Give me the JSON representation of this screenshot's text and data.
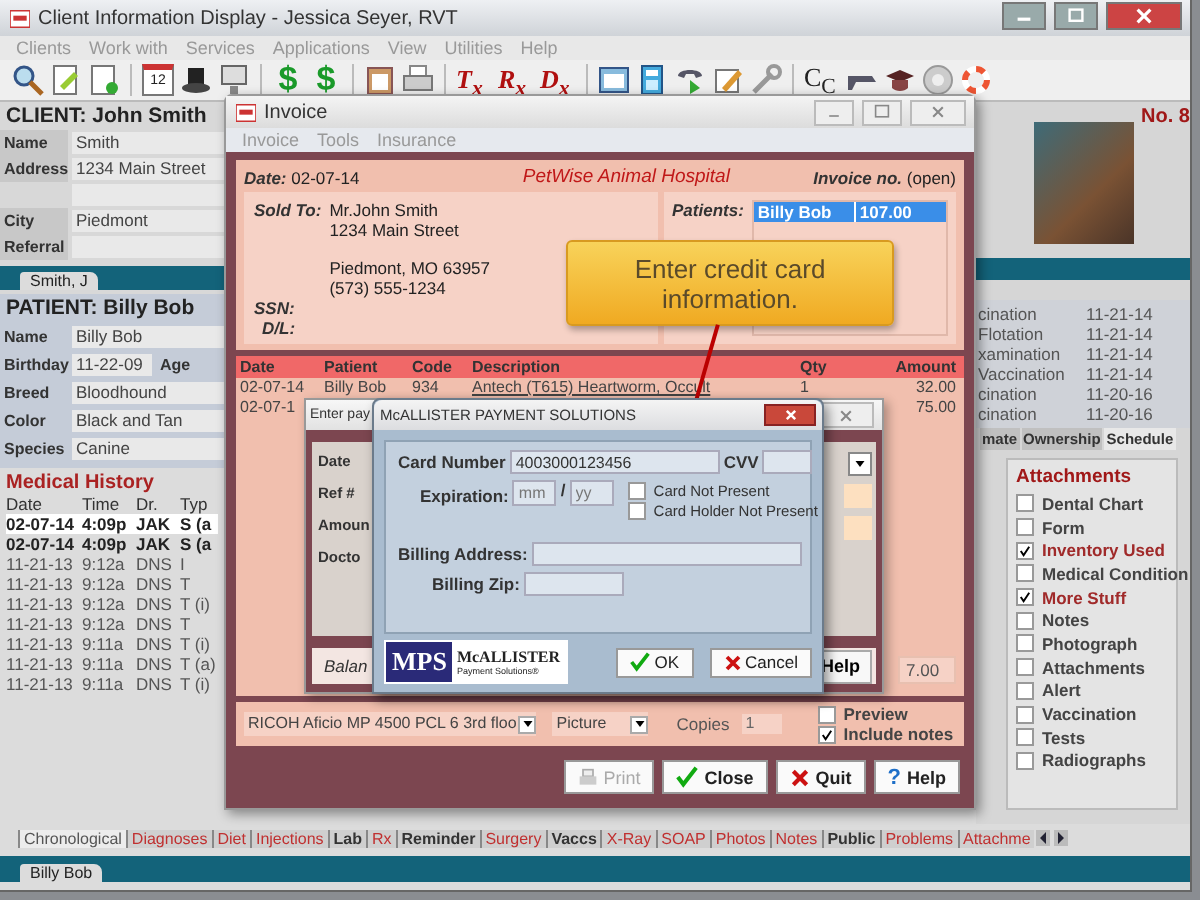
{
  "window": {
    "title": "Client Information Display - Jessica Seyer, RVT"
  },
  "menu": [
    {
      "label": "Clients",
      "disabled": true
    },
    {
      "label": "Work with",
      "disabled": true
    },
    {
      "label": "Services",
      "disabled": true
    },
    {
      "label": "Applications",
      "disabled": true
    },
    {
      "label": "View",
      "disabled": true
    },
    {
      "label": "Utilities",
      "disabled": true
    },
    {
      "label": "Help",
      "disabled": true
    }
  ],
  "toolbar": {
    "calendar_day": "12",
    "dollar_signs": [
      "$",
      "$"
    ],
    "rx_buttons": [
      "T$_{x}$",
      "R$_{x}$",
      "D$_{x}$"
    ],
    "cc_label": "C$_{C}$"
  },
  "client": {
    "heading": "CLIENT:",
    "name": "John Smith",
    "fields": [
      {
        "label": "Name",
        "value": "Smith",
        "kind": "line"
      },
      {
        "label": "Address",
        "value": "1234 Main Street",
        "kind": "address"
      },
      {
        "label": "City",
        "value": "Piedmont",
        "kind": "line"
      },
      {
        "label": "Referral",
        "kind": "line"
      }
    ]
  },
  "client_tab": "Smith, J",
  "patient": {
    "heading": "PATIENT:",
    "name": "Billy Bob",
    "fields": [
      {
        "label": "Name",
        "value": "Billy Bob"
      },
      {
        "label": "Birthday",
        "value": "11-22-09",
        "extra_label": "Age"
      },
      {
        "label": "Breed",
        "value": "Bloodhound"
      },
      {
        "label": "Color",
        "value": "Black and Tan"
      },
      {
        "label": "Species",
        "value": "Canine"
      }
    ]
  },
  "medical_history": {
    "title": "Medical History",
    "columns": [
      "Date",
      "Time",
      "Dr.",
      "Typ"
    ],
    "rows": [
      {
        "cells": [
          "02-07-14",
          "4:09p",
          "JAK",
          "S (a"
        ],
        "selected": true,
        "bold": true
      },
      {
        "cells": [
          "02-07-14",
          "4:09p",
          "JAK",
          "S (a"
        ],
        "selected": false,
        "bold": true
      },
      {
        "cells": [
          "11-21-13",
          "9:12a",
          "DNS",
          "I"
        ],
        "selected": false,
        "bold": false
      },
      {
        "cells": [
          "11-21-13",
          "9:12a",
          "DNS",
          "T"
        ],
        "selected": false,
        "bold": false
      },
      {
        "cells": [
          "11-21-13",
          "9:12a",
          "DNS",
          "T (i)"
        ],
        "selected": false,
        "bold": false
      },
      {
        "cells": [
          "11-21-13",
          "9:12a",
          "DNS",
          "T"
        ],
        "selected": false,
        "bold": false
      },
      {
        "cells": [
          "11-21-13",
          "9:11a",
          "DNS",
          "T (i)"
        ],
        "selected": false,
        "bold": false
      },
      {
        "cells": [
          "11-21-13",
          "9:11a",
          "DNS",
          "T (a)"
        ],
        "selected": false,
        "bold": false
      },
      {
        "cells": [
          "11-21-13",
          "9:11a",
          "DNS",
          "T (i)"
        ],
        "selected": false,
        "bold": false
      }
    ]
  },
  "record_tabs": [
    {
      "label": "Chronological",
      "selected": true,
      "empty": false
    },
    {
      "label": "Diagnoses",
      "selected": false,
      "empty": true
    },
    {
      "label": "Diet",
      "selected": false,
      "empty": true
    },
    {
      "label": "Injections",
      "selected": false,
      "empty": true
    },
    {
      "label": "Lab",
      "selected": false,
      "empty": false
    },
    {
      "label": "Rx",
      "selected": false,
      "empty": true
    },
    {
      "label": "Reminder",
      "selected": false,
      "empty": false
    },
    {
      "label": "Surgery",
      "selected": false,
      "empty": true
    },
    {
      "label": "Vaccs",
      "selected": false,
      "empty": false
    },
    {
      "label": "X-Ray",
      "selected": false,
      "empty": true
    },
    {
      "label": "SOAP",
      "selected": false,
      "empty": true
    },
    {
      "label": "Photos",
      "selected": false,
      "empty": true
    },
    {
      "label": "Notes",
      "selected": false,
      "empty": true
    },
    {
      "label": "Public",
      "selected": false,
      "empty": false
    },
    {
      "label": "Problems",
      "selected": false,
      "empty": true
    },
    {
      "label": "Attachme",
      "selected": false,
      "empty": true
    }
  ],
  "patient_tab": "Billy Bob",
  "right_panel": {
    "number": "No. 8",
    "vaccinations": [
      {
        "name": "cination",
        "date": "11-21-14"
      },
      {
        "name": "Flotation",
        "date": "11-21-14"
      },
      {
        "name": "xamination",
        "date": "11-21-14"
      },
      {
        "name": "Vaccination",
        "date": "11-21-14"
      },
      {
        "name": "cination",
        "date": "11-20-16"
      },
      {
        "name": "cination",
        "date": "11-20-16"
      }
    ],
    "tabs": [
      {
        "label": "mate",
        "selected": false
      },
      {
        "label": "Ownership",
        "selected": false
      },
      {
        "label": "Schedule",
        "selected": true
      }
    ]
  },
  "attachments": {
    "title": "Attachments",
    "items": [
      {
        "label": "Dental Chart",
        "checked": false
      },
      {
        "label": "Form",
        "checked": false
      },
      {
        "label": "Inventory Used",
        "checked": true
      },
      {
        "label": "Medical Condition",
        "checked": false
      },
      {
        "label": "More Stuff",
        "checked": true
      },
      {
        "label": "Notes",
        "checked": false
      },
      {
        "label": "Photograph",
        "checked": false
      },
      {
        "label": "Attachments",
        "checked": false
      },
      {
        "label": "Alert",
        "checked": false
      },
      {
        "label": "Vaccination",
        "checked": false
      },
      {
        "label": "Tests",
        "checked": false
      },
      {
        "label": "Radiographs",
        "checked": false
      }
    ]
  },
  "invoice": {
    "title": "Invoice",
    "menu": [
      "Invoice",
      "Tools",
      "Insurance"
    ],
    "date_label": "Date:",
    "date": "02-07-14",
    "hospital": "PetWise Animal Hospital",
    "invoice_no_label": "Invoice no.",
    "invoice_no": "(open)",
    "sold_to_label": "Sold To:",
    "address_lines": [
      "Mr.John Smith",
      "1234 Main Street"
    ],
    "city_lines": [
      "Piedmont, MO  63957",
      "(573) 555-1234"
    ],
    "ssn_label": "SSN:",
    "dl_label": "D/L:",
    "patients_label": "Patients:",
    "patients": [
      {
        "name": "Billy Bob",
        "amount": "107.00",
        "selected": true
      }
    ],
    "columns": [
      "Date",
      "Patient",
      "Code",
      "Description",
      "Qty",
      "Amount"
    ],
    "items": [
      {
        "date": "02-07-14",
        "patient": "Billy Bob",
        "code": "934",
        "description": "Antech (T615) Heartworm, Occult",
        "qty": "1",
        "amount": "32.00"
      },
      {
        "date": "02-07-1",
        "amount": "75.00"
      }
    ],
    "balance": "7.00",
    "printer": "RICOH Aficio MP 4500 PCL 6 3rd floo",
    "format": "Picture",
    "copies_label": "Copies",
    "copies": "1",
    "options": [
      {
        "label": "Preview",
        "checked": false
      },
      {
        "label": "Include notes",
        "checked": true
      }
    ],
    "buttons": [
      {
        "label": "Print",
        "kind": "print",
        "disabled": true
      },
      {
        "label": "Close",
        "kind": "close",
        "disabled": false
      },
      {
        "label": "Quit",
        "kind": "quit",
        "disabled": false
      },
      {
        "label": "Help",
        "kind": "help",
        "disabled": false,
        "glyph": "?"
      }
    ]
  },
  "payment_window": {
    "title": "Enter pay",
    "labels": [
      "Date",
      "Ref #",
      "Amoun",
      "Docto"
    ],
    "balance_label": "Balan",
    "help_button": "Help"
  },
  "mcallister": {
    "title": "McALLISTER PAYMENT SOLUTIONS",
    "card_number_label": "Card Number",
    "card_number": "4003000123456",
    "cvv_label": "CVV",
    "expiration_label": "Expiration:",
    "month_placeholder": "mm",
    "separator": "/",
    "year_placeholder": "yy",
    "checks": [
      {
        "label": "Card Not Present",
        "checked": false
      },
      {
        "label": "Card Holder Not Present",
        "checked": false
      }
    ],
    "billing_address_label": "Billing Address:",
    "billing_zip_label": "Billing Zip:",
    "logo_mark": "MPS",
    "logo_name": "McALLISTER",
    "logo_tagline": "Payment Solutions®",
    "ok": "OK",
    "cancel": "Cancel"
  },
  "callout": "Enter credit card information."
}
